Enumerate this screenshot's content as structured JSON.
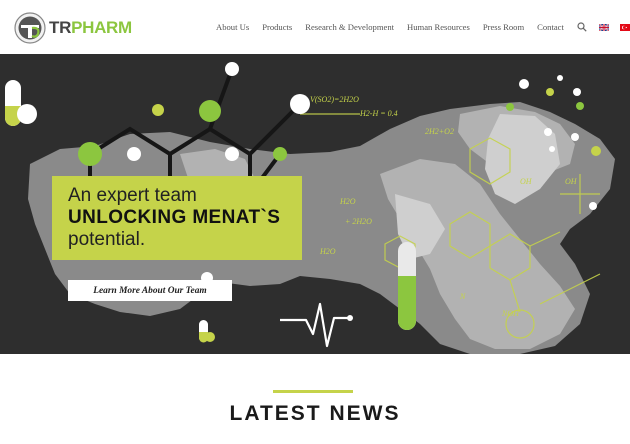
{
  "header": {
    "logo": {
      "brand_prefix": "TR",
      "brand_suffix": "PHARM"
    },
    "nav": [
      {
        "label": "About Us"
      },
      {
        "label": "Products"
      },
      {
        "label": "Research & Development"
      },
      {
        "label": "Human Resources"
      },
      {
        "label": "Press Room"
      },
      {
        "label": "Contact"
      }
    ],
    "search_icon": "search-icon",
    "languages": [
      {
        "name": "English",
        "icon": "uk-flag-icon"
      },
      {
        "name": "Turkish",
        "icon": "turkey-flag-icon"
      }
    ]
  },
  "hero": {
    "headline_line1": "An expert team",
    "headline_line2": "UNLOCKING MENAT`S",
    "headline_line3": "potential.",
    "cta_label": "Learn More About Our Team"
  },
  "news": {
    "title": "LATEST NEWS"
  },
  "colors": {
    "accent": "#c5d34a",
    "brand_green": "#8cc63f",
    "hero_bg": "#2e2e2e",
    "map_gray": "#8a8a8a"
  }
}
